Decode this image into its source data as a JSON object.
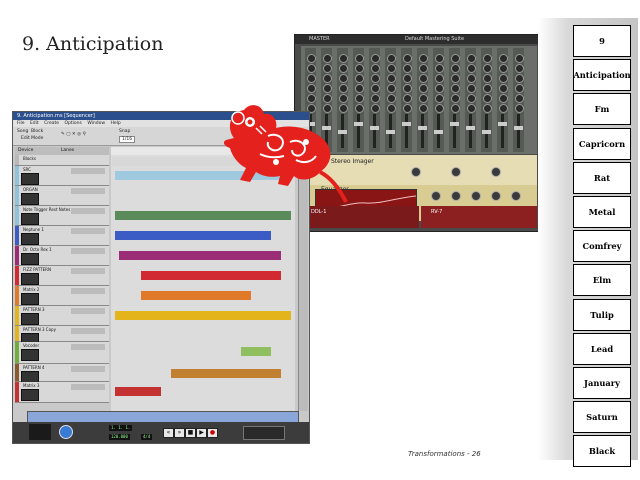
{
  "slide": {
    "title": "9. Anticipation",
    "caption": "Transformations - 26"
  },
  "associations": [
    "9",
    "Anticipation",
    "Fm",
    "Capricorn",
    "Rat",
    "Metal",
    "Comfrey",
    "Elm",
    "Tulip",
    "Lead",
    "January",
    "Saturn",
    "Black"
  ],
  "sequencer": {
    "window_title": "9. Anticipation.rns [Sequencer]",
    "menu": [
      "File",
      "Edit",
      "Create",
      "Options",
      "Window",
      "Help"
    ],
    "toolbar": {
      "mode_label": "Song",
      "block_label": "Block",
      "edit_mode_label": "Edit Mode",
      "snap_label": "Snap",
      "snap_value": "1/16"
    },
    "header": {
      "device_label": "Device",
      "lanes_label": "Lanes"
    },
    "tracks": [
      {
        "name": "Blocks",
        "color": "#b8b8b8"
      },
      {
        "name": "SRC",
        "color": "#8fc3d9"
      },
      {
        "name": "ORGAN",
        "color": "#8fc3d9"
      },
      {
        "name": "Note Trigger Rest Notes",
        "color": "#8fc3d9"
      },
      {
        "name": "Neptune 1",
        "color": "#3b5cc4"
      },
      {
        "name": "Dr. Octo Rex 1",
        "color": "#9b2d77"
      },
      {
        "name": "FIZZ PATTERN",
        "color": "#d12a33"
      },
      {
        "name": "Matrix 2",
        "color": "#e07a2a"
      },
      {
        "name": "PATTERN 3",
        "color": "#e3b41b"
      },
      {
        "name": "PATTERN 3 Copy",
        "color": "#e3b41b"
      },
      {
        "name": "Vocoder",
        "color": "#6fae3d"
      },
      {
        "name": "PATTERN 4",
        "color": "#8a5a2c"
      },
      {
        "name": "Matrix 3",
        "color": "#c43131"
      }
    ],
    "transport": {
      "position": "1. 1. 1.",
      "tempo": "120.000",
      "signature": "4/4"
    }
  },
  "rack": {
    "mixer_label": "Reason Mixer",
    "imager_label": "Stereo Imager",
    "eq_label": "Equalizer",
    "ddl_label": "DDL-1",
    "rv7_label": "RV-7",
    "master_label": "Default Mastering Suite"
  },
  "colors": {
    "rat": "#e4211c",
    "window_title": "#2b4f8c",
    "eq_screen": "#8a1515"
  }
}
